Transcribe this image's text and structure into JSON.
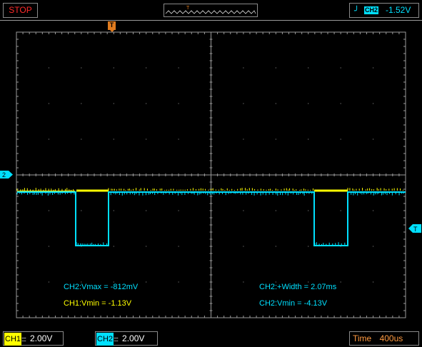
{
  "status": "STOP",
  "trigger": {
    "channel": "CH2",
    "level": "-1.52V",
    "edge_icon": "rising-edge-icon",
    "marker_label": "T"
  },
  "timebase_window": {
    "marker_label": "T"
  },
  "markers": {
    "ch2_label": "2",
    "trigger_level_label": "T"
  },
  "measurements": {
    "ch2_vmax": "CH2:Vmax = -812mV",
    "ch1_vmin": "CH1:Vmin = -1.13V",
    "ch2_width": "CH2:+Width = 2.07ms",
    "ch2_vmin": "CH2:Vmin = -4.13V"
  },
  "ch1": {
    "label": "CH1",
    "scale": "2.00V",
    "color": "#ffff00"
  },
  "ch2": {
    "label": "CH2",
    "scale": "2.00V",
    "color": "#00e0ff"
  },
  "time": {
    "label": "Time",
    "value": "400us"
  },
  "colors": {
    "stop": "#ff2a2a",
    "ch1": "#ffff00",
    "ch2": "#00e0ff",
    "time": "#ff9a40",
    "grid": "#9a9a9a"
  }
}
